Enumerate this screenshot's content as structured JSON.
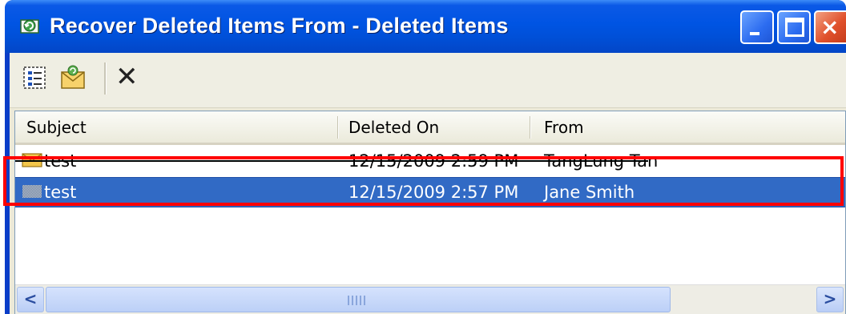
{
  "window": {
    "title": "Recover Deleted Items From -  Deleted Items",
    "controls": {
      "minimize": "minimize",
      "maximize": "maximize",
      "close": "×"
    }
  },
  "toolbar": {
    "buttons": [
      {
        "icon": "select-all-icon"
      },
      {
        "icon": "recover-envelope-icon"
      },
      {
        "icon": "delete-icon",
        "glyph": "✕"
      }
    ]
  },
  "list": {
    "columns": [
      "Subject",
      "Deleted On",
      "From"
    ],
    "rows": [
      {
        "subject": "test",
        "deleted_on": "12/15/2009 2:59 PM",
        "from": "TangLung Tan",
        "icon": "envelope-icon",
        "struck": true
      },
      {
        "subject": "test",
        "deleted_on": "12/15/2009 2:57 PM",
        "from": "Jane Smith",
        "icon": "message-icon",
        "selected": true
      }
    ]
  },
  "scrollbar": {
    "left": "<",
    "right": ">"
  },
  "colors": {
    "titlebar": "#0054e3",
    "selection": "#316ac5",
    "highlight": "#ff0000"
  }
}
